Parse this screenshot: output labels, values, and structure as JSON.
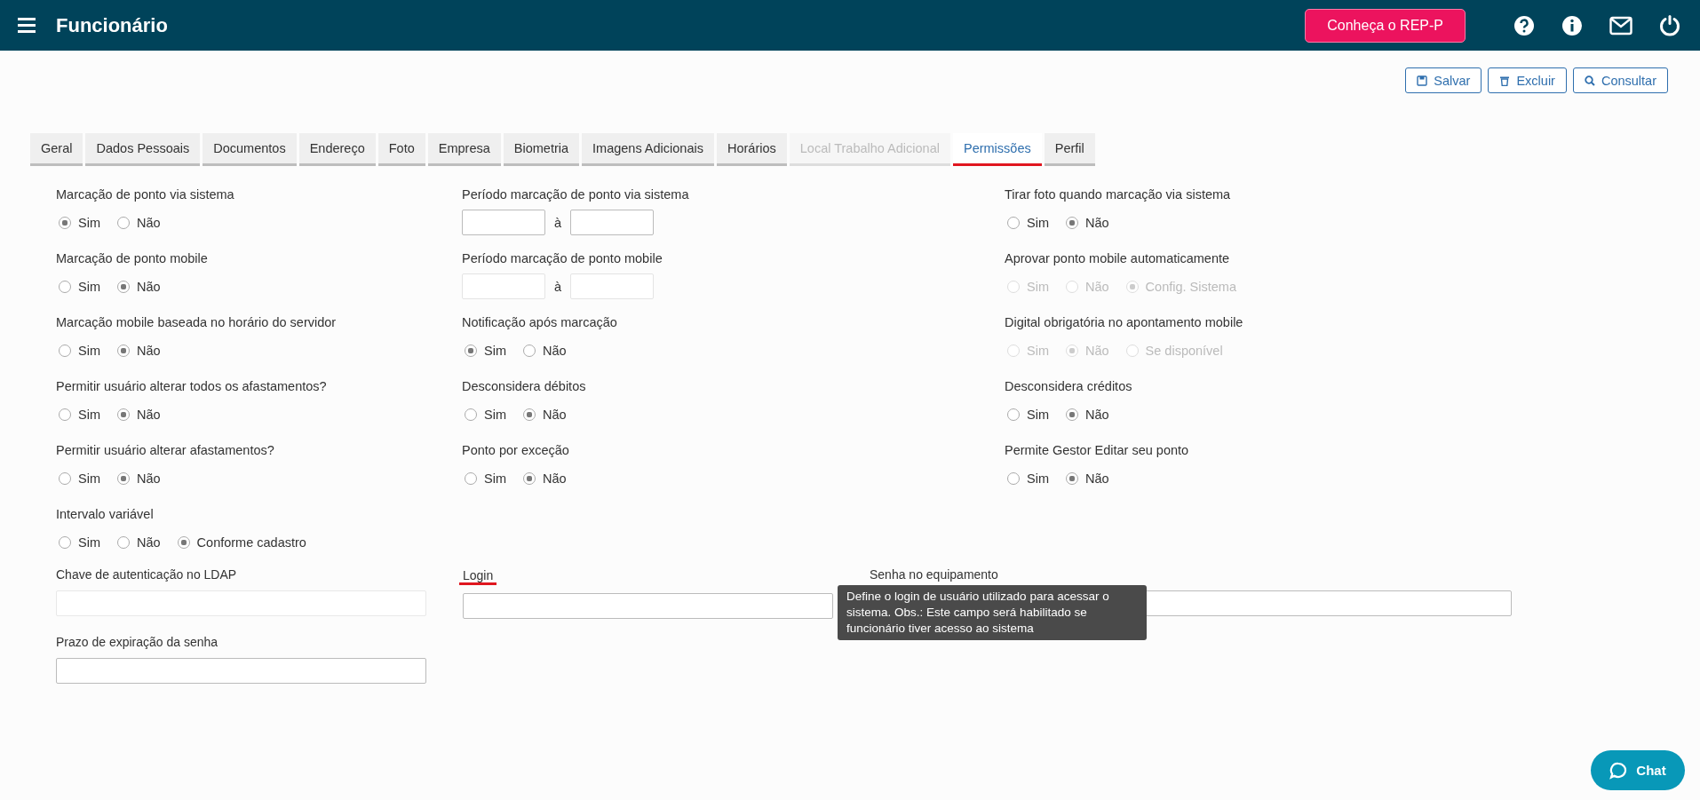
{
  "header": {
    "title": "Funcionário",
    "promo_button": "Conheça o REP-P"
  },
  "actions": [
    {
      "label": "Salvar",
      "kind": "save"
    },
    {
      "label": "Excluir",
      "kind": "delete"
    },
    {
      "label": "Consultar",
      "kind": "search"
    }
  ],
  "tabs": [
    {
      "label": "Geral",
      "selected": false,
      "disabled": false
    },
    {
      "label": "Dados Pessoais",
      "selected": false,
      "disabled": false
    },
    {
      "label": "Documentos",
      "selected": false,
      "disabled": false
    },
    {
      "label": "Endereço",
      "selected": false,
      "disabled": false
    },
    {
      "label": "Foto",
      "selected": false,
      "disabled": false
    },
    {
      "label": "Empresa",
      "selected": false,
      "disabled": false
    },
    {
      "label": "Biometria",
      "selected": false,
      "disabled": false
    },
    {
      "label": "Imagens Adicionais",
      "selected": false,
      "disabled": false
    },
    {
      "label": "Horários",
      "selected": false,
      "disabled": false
    },
    {
      "label": "Local Trabalho Adicional",
      "selected": false,
      "disabled": true
    },
    {
      "label": "Permissões",
      "selected": true,
      "disabled": false
    },
    {
      "label": "Perfil",
      "selected": false,
      "disabled": false
    }
  ],
  "columns": [
    [
      {
        "kind": "radio",
        "label": "Marcação de ponto via sistema",
        "disabled": false,
        "options": [
          {
            "label": "Sim",
            "selected": true
          },
          {
            "label": "Não",
            "selected": false
          }
        ]
      },
      {
        "kind": "radio",
        "label": "Marcação de ponto mobile",
        "disabled": false,
        "options": [
          {
            "label": "Sim",
            "selected": false
          },
          {
            "label": "Não",
            "selected": true
          }
        ]
      },
      {
        "kind": "radio",
        "label": "Marcação mobile baseada no horário do servidor",
        "disabled": false,
        "options": [
          {
            "label": "Sim",
            "selected": false
          },
          {
            "label": "Não",
            "selected": true
          }
        ]
      },
      {
        "kind": "radio",
        "label": "Permitir usuário alterar todos os afastamentos?",
        "disabled": false,
        "options": [
          {
            "label": "Sim",
            "selected": false
          },
          {
            "label": "Não",
            "selected": true
          }
        ]
      },
      {
        "kind": "radio",
        "label": "Permitir usuário alterar afastamentos?",
        "disabled": false,
        "options": [
          {
            "label": "Sim",
            "selected": false
          },
          {
            "label": "Não",
            "selected": true
          }
        ]
      },
      {
        "kind": "radio",
        "label": "Intervalo variável",
        "disabled": false,
        "options": [
          {
            "label": "Sim",
            "selected": false
          },
          {
            "label": "Não",
            "selected": false
          },
          {
            "label": "Conforme cadastro",
            "selected": true
          }
        ]
      }
    ],
    [
      {
        "kind": "range",
        "label": "Período marcação de ponto via sistema",
        "disabled": false,
        "separator": "à"
      },
      {
        "kind": "range",
        "label": "Período marcação de ponto mobile",
        "disabled": true,
        "separator": "à"
      },
      {
        "kind": "radio",
        "label": "Notificação após marcação",
        "disabled": false,
        "options": [
          {
            "label": "Sim",
            "selected": true
          },
          {
            "label": "Não",
            "selected": false
          }
        ]
      },
      {
        "kind": "radio",
        "label": "Desconsidera débitos",
        "disabled": false,
        "options": [
          {
            "label": "Sim",
            "selected": false
          },
          {
            "label": "Não",
            "selected": true
          }
        ]
      },
      {
        "kind": "radio",
        "label": "Ponto por exceção",
        "disabled": false,
        "options": [
          {
            "label": "Sim",
            "selected": false
          },
          {
            "label": "Não",
            "selected": true
          }
        ]
      }
    ],
    [
      {
        "kind": "radio",
        "label": "Tirar foto quando marcação via sistema",
        "disabled": false,
        "options": [
          {
            "label": "Sim",
            "selected": false
          },
          {
            "label": "Não",
            "selected": true
          }
        ]
      },
      {
        "kind": "radio",
        "label": "Aprovar ponto mobile automaticamente",
        "disabled": true,
        "options": [
          {
            "label": "Sim",
            "selected": false
          },
          {
            "label": "Não",
            "selected": false
          },
          {
            "label": "Config. Sistema",
            "selected": true
          }
        ]
      },
      {
        "kind": "radio",
        "label": "Digital obrigatória no apontamento mobile",
        "disabled": true,
        "options": [
          {
            "label": "Sim",
            "selected": false
          },
          {
            "label": "Não",
            "selected": true
          },
          {
            "label": "Se disponível",
            "selected": false
          }
        ]
      },
      {
        "kind": "radio",
        "label": "Desconsidera créditos",
        "disabled": false,
        "options": [
          {
            "label": "Sim",
            "selected": false
          },
          {
            "label": "Não",
            "selected": true
          }
        ]
      },
      {
        "kind": "radio",
        "label": "Permite Gestor Editar seu ponto",
        "disabled": false,
        "options": [
          {
            "label": "Sim",
            "selected": false
          },
          {
            "label": "Não",
            "selected": true
          }
        ]
      }
    ]
  ],
  "text_fields": [
    {
      "label": "Chave de autenticação no LDAP",
      "disabled": true,
      "hovered": false
    },
    {
      "label": "Login",
      "disabled": false,
      "hovered": true
    },
    {
      "label": "Senha no equipamento",
      "disabled": false,
      "hovered": false
    },
    {
      "label": "Prazo de expiração da senha",
      "disabled": false,
      "hovered": false
    }
  ],
  "tooltip": {
    "text": "Define o login de usuário utilizado para acessar o sistema. Obs.: Este campo será habilitado se funcionário tiver acesso ao sistema"
  },
  "chat": {
    "label": "Chat"
  }
}
